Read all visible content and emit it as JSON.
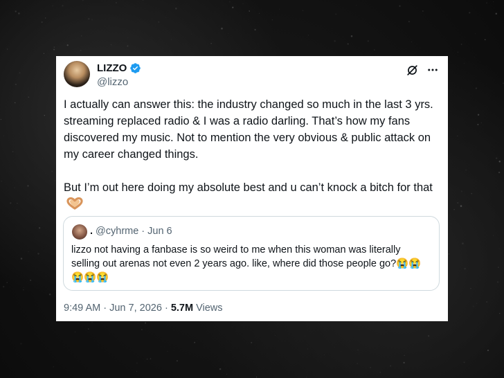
{
  "tweet": {
    "display_name": "LIZZO",
    "handle": "@lizzo",
    "body": "I actually can answer this: the industry changed so much in the last 3 yrs. streaming replaced radio & I was a radio darling. That’s how my fans discovered my music. Not to mention the very obvious & public attack on my career changed things.\n\nBut I’m out here doing my absolute best and u can’t knock a bitch for that",
    "time": "9:49 AM",
    "date": "Jun 7, 2026",
    "views_count": "5.7M",
    "views_label": "Views",
    "sep": "·"
  },
  "quote": {
    "name": ".",
    "handle": "@cyhrme",
    "date": "Jun 6",
    "sep": "·",
    "text": "lizzo not having a fanbase is so weird to me when this woman was literally selling out arenas not even 2 years ago. like, where did those people go?😭😭 😭😭😭"
  },
  "icons": {
    "verified": "verified-badge-icon",
    "grok": "grok-icon",
    "more": "more-icon",
    "heart_hands": "heart-hands-emoji"
  },
  "colors": {
    "verified": "#1d9bf0",
    "secondary_text": "#536471",
    "primary_text": "#0f1419",
    "card": "#ffffff",
    "background": "#121212"
  }
}
